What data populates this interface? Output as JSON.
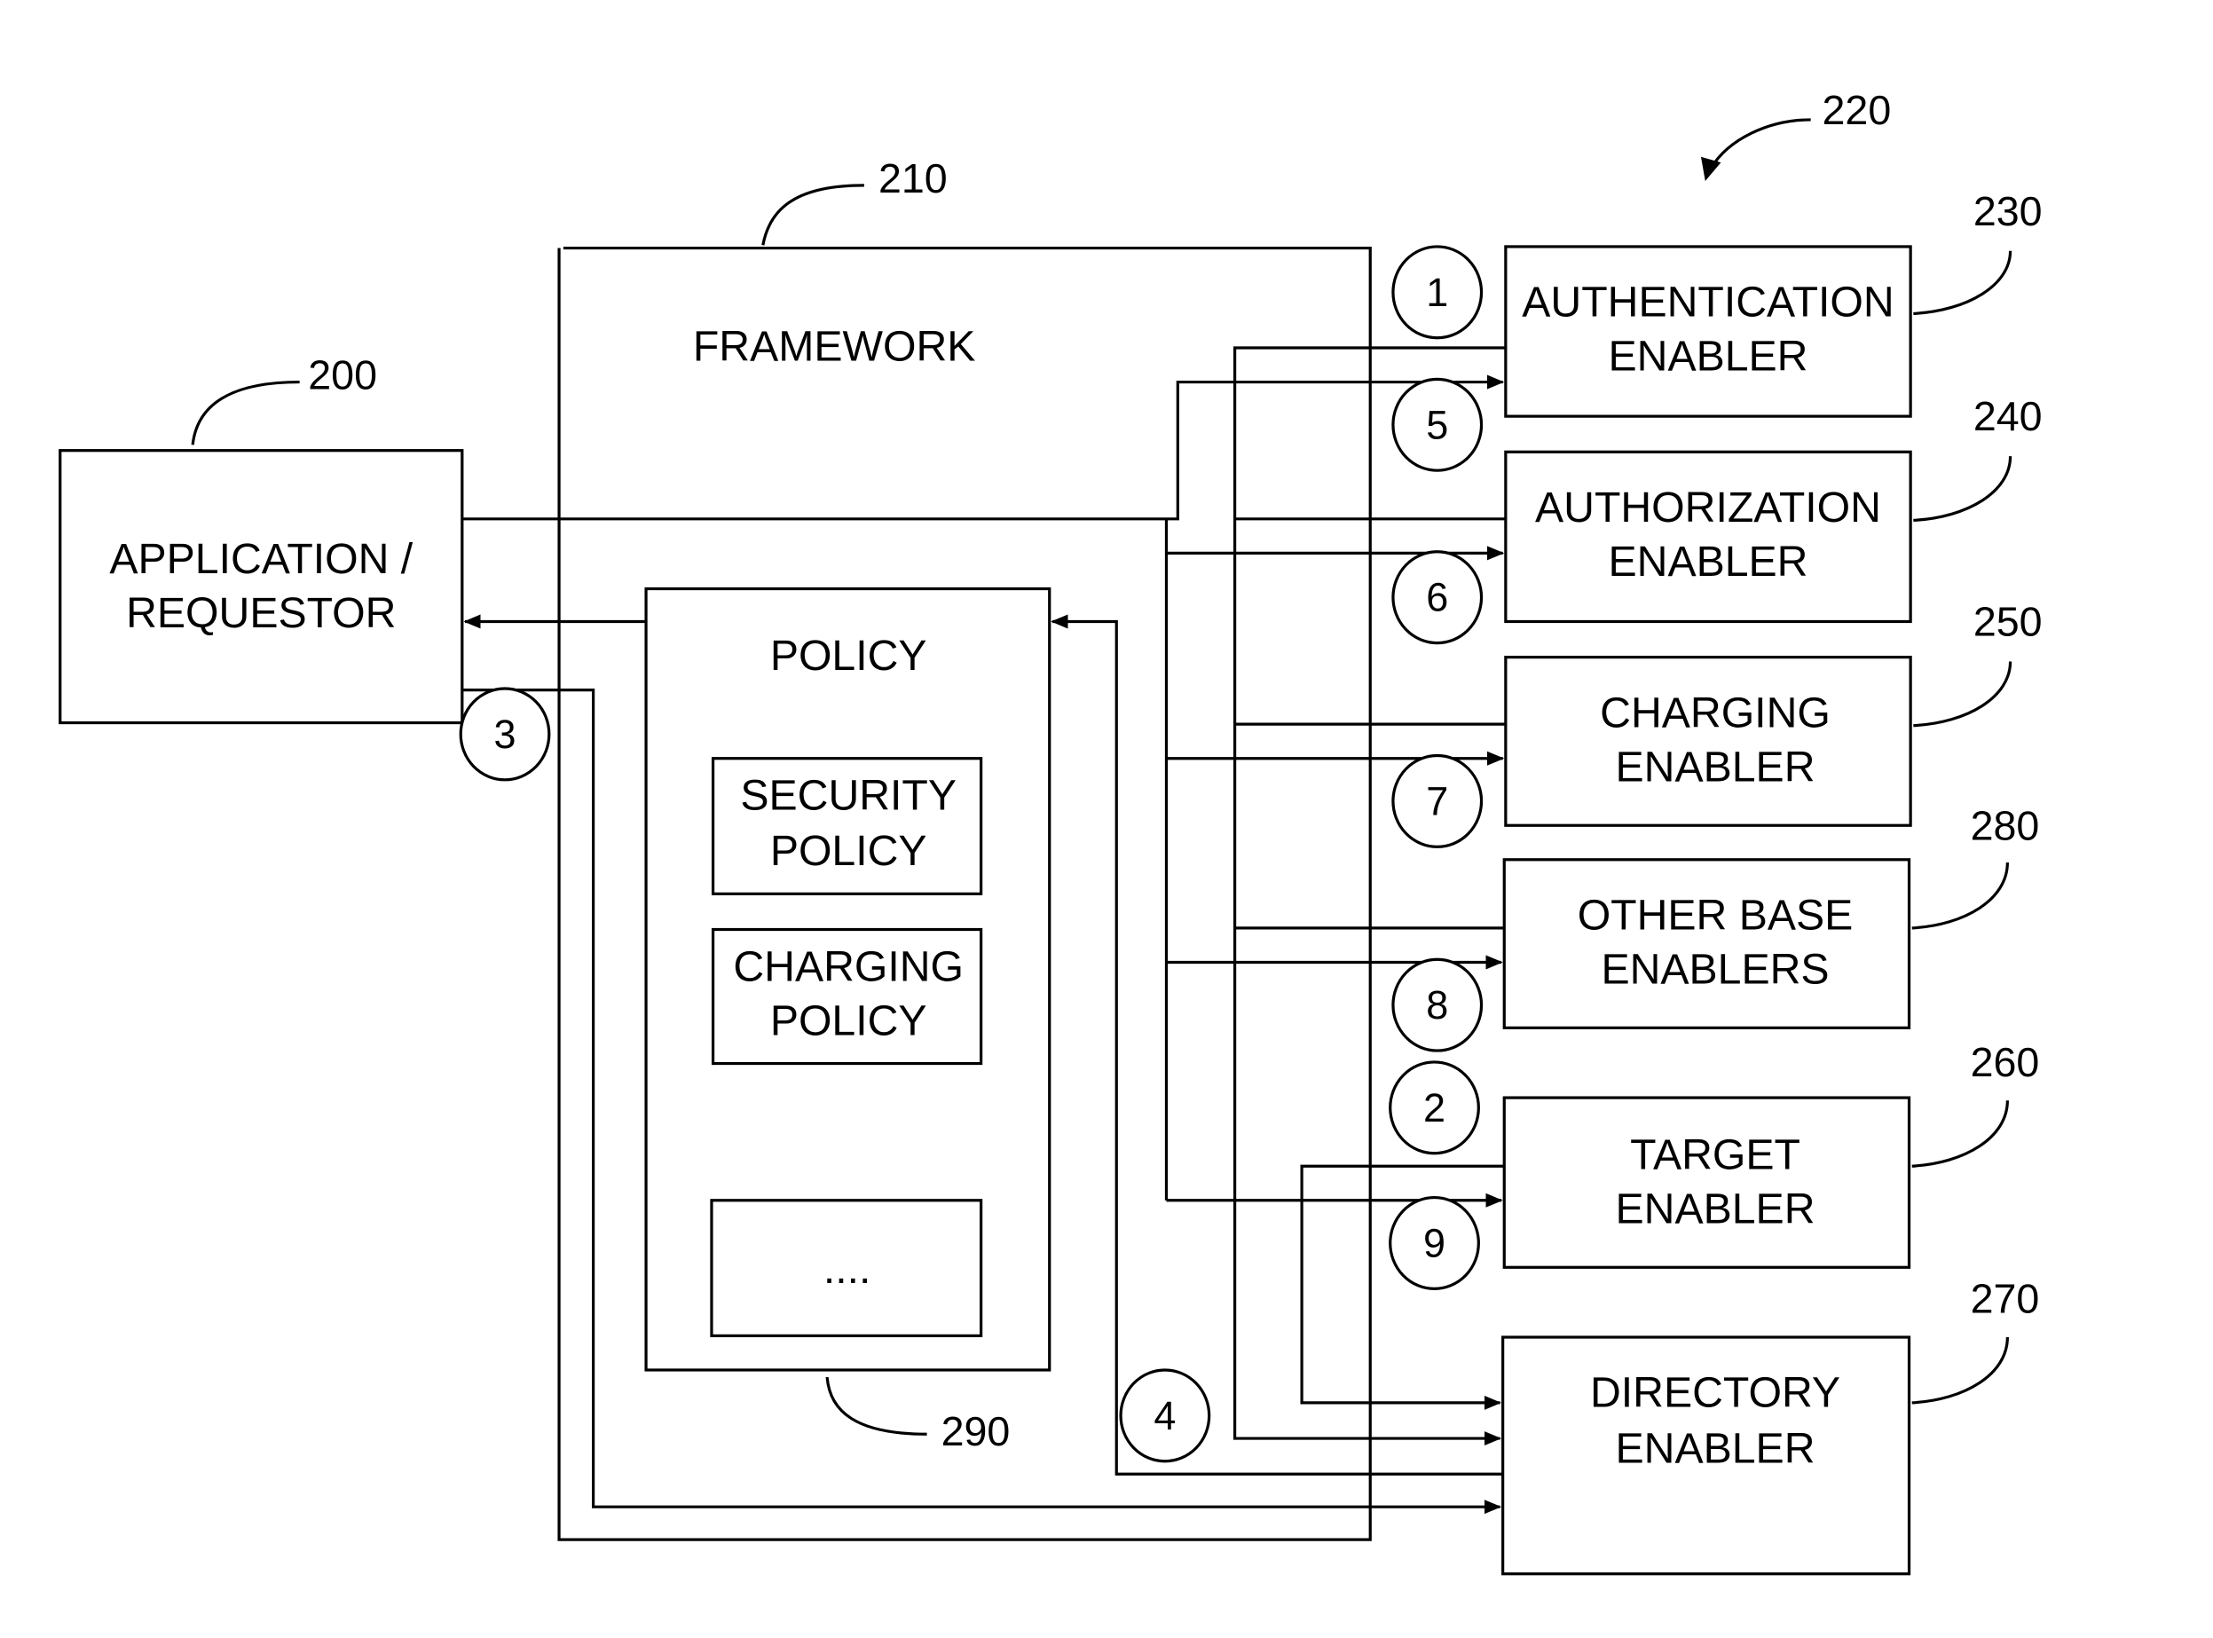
{
  "figure": {
    "refs": {
      "application": "200",
      "framework": "210",
      "enablers_group": "220",
      "authentication": "230",
      "authorization": "240",
      "charging": "250",
      "target": "260",
      "directory": "270",
      "other_base": "280",
      "policy": "290"
    },
    "application": {
      "line1": "APPLICATION /",
      "line2": "REQUESTOR"
    },
    "framework": {
      "label": "FRAMEWORK"
    },
    "policy": {
      "label": "POLICY",
      "security": {
        "line1": "SECURITY",
        "line2": "POLICY"
      },
      "charging": {
        "line1": "CHARGING",
        "line2": "POLICY"
      },
      "more": "...."
    },
    "enablers": {
      "authentication": {
        "line1": "AUTHENTICATION",
        "line2": "ENABLER"
      },
      "authorization": {
        "line1": "AUTHORIZATION",
        "line2": "ENABLER"
      },
      "charging": {
        "line1": "CHARGING",
        "line2": "ENABLER"
      },
      "other_base": {
        "line1": "OTHER BASE",
        "line2": "ENABLERS"
      },
      "target": {
        "line1": "TARGET",
        "line2": "ENABLER"
      },
      "directory": {
        "line1": "DIRECTORY",
        "line2": "ENABLER"
      }
    },
    "steps": [
      "1",
      "2",
      "3",
      "4",
      "5",
      "6",
      "7",
      "8",
      "9"
    ]
  }
}
